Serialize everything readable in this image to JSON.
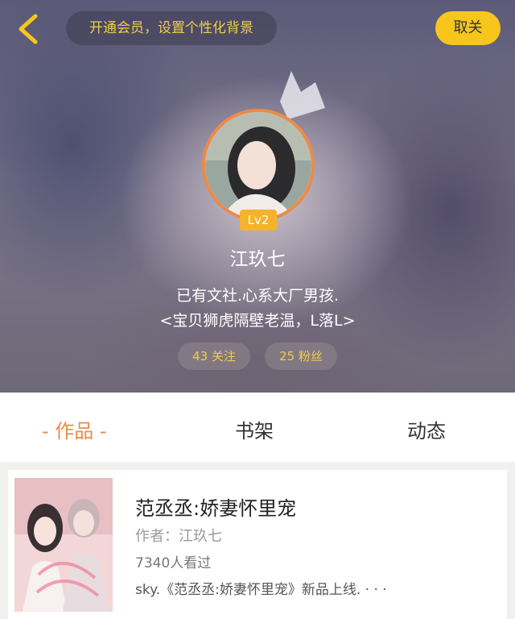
{
  "header": {
    "vip_prompt": "开通会员，设置个性化背景",
    "unfollow_label": "取关"
  },
  "profile": {
    "level": "Lv2",
    "username": "江玖七",
    "bio_line1": "已有文社.心系大厂男孩.",
    "bio_line2": "<宝贝狮虎隔壁老温，L落L>",
    "following": "43 关注",
    "fans": "25 粉丝"
  },
  "tabs": [
    {
      "label": "- 作品 -",
      "active": true
    },
    {
      "label": "书架",
      "active": false
    },
    {
      "label": "动态",
      "active": false
    }
  ],
  "works": [
    {
      "title": "范丞丞:娇妻怀里宠",
      "author": "作者：江玖七",
      "views": "7340人看过",
      "description": "sky.《范丞丞:娇妻怀里宠》新品上线. · · ·"
    }
  ],
  "colors": {
    "accent_yellow": "#f6c61c",
    "accent_orange": "#ee8a45",
    "stat_text": "#f1cc4a"
  },
  "icons": [
    "chevron-left-icon",
    "crown-icon"
  ]
}
